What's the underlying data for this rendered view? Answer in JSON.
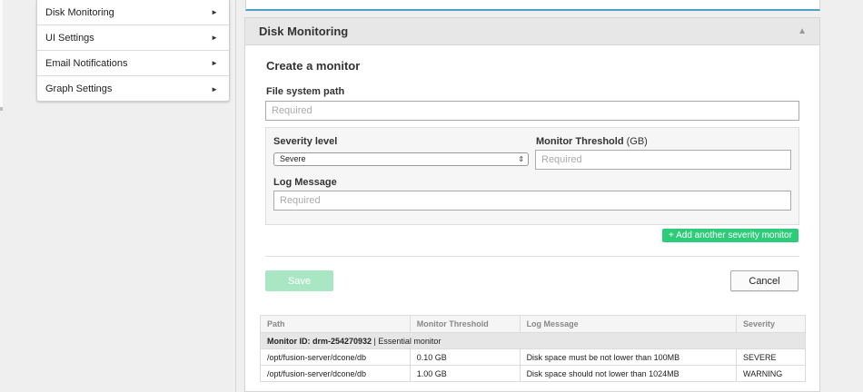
{
  "sidebar": {
    "items": [
      {
        "label": "Disk Monitoring"
      },
      {
        "label": "UI Settings"
      },
      {
        "label": "Email Notifications"
      },
      {
        "label": "Graph Settings"
      }
    ],
    "arrow_glyph": "►"
  },
  "panel": {
    "title": "Disk Monitoring",
    "collapse_glyph": "▲"
  },
  "form": {
    "title": "Create a monitor",
    "path_label": "File system path",
    "path_placeholder": "Required",
    "severity_label": "Severity level",
    "severity_value": "Severe",
    "threshold_label": "Monitor Threshold",
    "threshold_unit": "(GB)",
    "threshold_placeholder": "Required",
    "log_label": "Log Message",
    "log_placeholder": "Required",
    "add_button": "+ Add another severity monitor",
    "save_button": "Save",
    "cancel_button": "Cancel"
  },
  "table": {
    "headers": [
      "Path",
      "Monitor Threshold",
      "Log Message",
      "Severity"
    ],
    "group": {
      "id_label": "Monitor ID: drm-254270932",
      "sep": " | ",
      "note": "Essential monitor"
    },
    "rows": [
      {
        "path": "/opt/fusion-server/dcone/db",
        "threshold": "0.10 GB",
        "message": "Disk space must be not lower than 100MB",
        "severity": "SEVERE"
      },
      {
        "path": "/opt/fusion-server/dcone/db",
        "threshold": "1.00 GB",
        "message": "Disk space should not lower than 1024MB",
        "severity": "WARNING"
      }
    ]
  },
  "colors": {
    "accent_blue": "#4aa3c7",
    "green": "#2ecc7a",
    "green_disabled": "#a9e6c4"
  }
}
